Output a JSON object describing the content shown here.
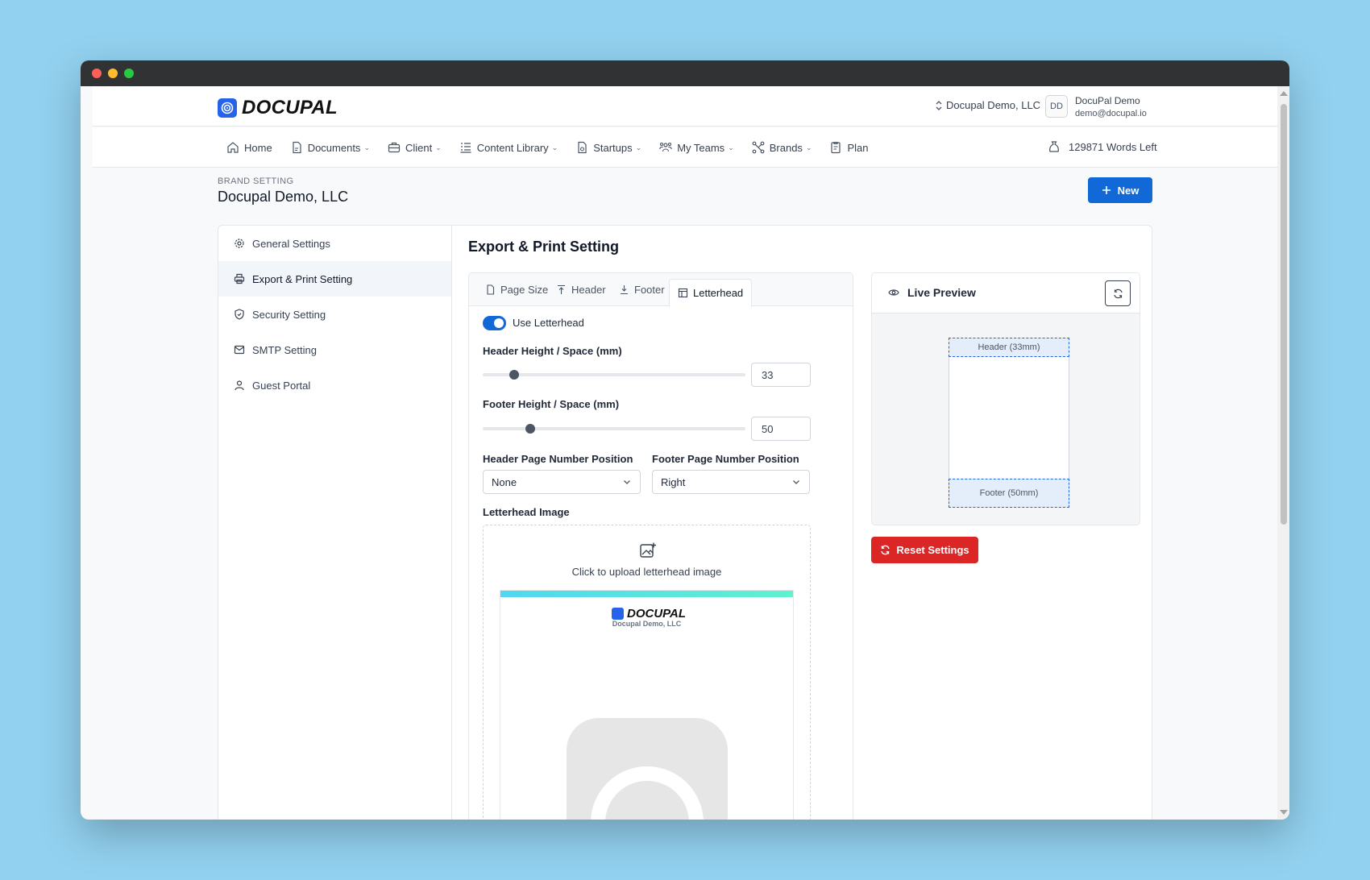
{
  "app": {
    "logo_text": "DOCUPAL",
    "org_switch": "Docupal Demo, LLC",
    "user": {
      "initials": "DD",
      "name": "DocuPal Demo",
      "email": "demo@docupal.io"
    }
  },
  "nav": {
    "items": [
      {
        "label": "Home",
        "icon": "home-icon",
        "dropdown": false
      },
      {
        "label": "Documents",
        "icon": "document-icon",
        "dropdown": true
      },
      {
        "label": "Client",
        "icon": "briefcase-icon",
        "dropdown": true
      },
      {
        "label": "Content Library",
        "icon": "list-icon",
        "dropdown": true
      },
      {
        "label": "Startups",
        "icon": "file-icon",
        "dropdown": true
      },
      {
        "label": "My Teams",
        "icon": "team-icon",
        "dropdown": true
      },
      {
        "label": "Brands",
        "icon": "brands-icon",
        "dropdown": true
      },
      {
        "label": "Plan",
        "icon": "plan-icon",
        "dropdown": false
      }
    ],
    "words_left": "129871 Words Left"
  },
  "page": {
    "section_label": "BRAND SETTING",
    "title": "Docupal Demo, LLC",
    "new_button": "New"
  },
  "sidebar": {
    "items": [
      {
        "label": "General Settings",
        "icon": "gear-icon",
        "active": false
      },
      {
        "label": "Export & Print Setting",
        "icon": "printer-icon",
        "active": true
      },
      {
        "label": "Security Setting",
        "icon": "shield-icon",
        "active": false
      },
      {
        "label": "SMTP Setting",
        "icon": "mail-icon",
        "active": false
      },
      {
        "label": "Guest Portal",
        "icon": "user-icon",
        "active": false
      }
    ]
  },
  "export": {
    "title": "Export & Print Setting",
    "tabs": [
      {
        "label": "Page Size",
        "active": false
      },
      {
        "label": "Header",
        "active": false
      },
      {
        "label": "Footer",
        "active": false
      },
      {
        "label": "Letterhead",
        "active": true
      }
    ],
    "use_letterhead_label": "Use Letterhead",
    "use_letterhead": true,
    "header_height_label": "Header Height / Space (mm)",
    "header_height": "33",
    "header_slider_fraction": 0.12,
    "footer_height_label": "Footer Height / Space (mm)",
    "footer_height": "50",
    "footer_slider_fraction": 0.18,
    "header_page_number_label": "Header Page Number Position",
    "header_page_number_value": "None",
    "footer_page_number_label": "Footer Page Number Position",
    "footer_page_number_value": "Right",
    "letterhead_image_label": "Letterhead Image",
    "upload_text": "Click to upload letterhead image",
    "letterhead_logo_text": "DOCUPAL",
    "letterhead_org": "Docupal Demo, LLC"
  },
  "preview": {
    "title": "Live Preview",
    "header_box": "Header (33mm)",
    "footer_box": "Footer (50mm)",
    "reset_button": "Reset Settings"
  },
  "colors": {
    "primary": "#1168d7",
    "danger": "#dc2626",
    "preview_box": "#e4eefb"
  }
}
